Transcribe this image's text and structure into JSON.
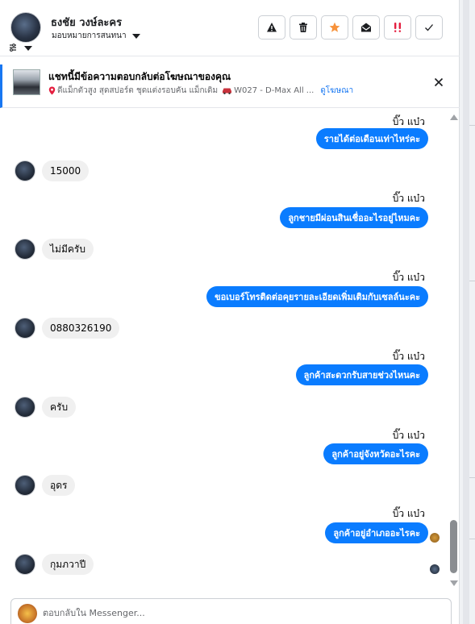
{
  "header": {
    "name": "ธงชัย วงษ์ละคร",
    "assign_label": "มอบหมายการสนทนา",
    "actions": [
      {
        "icon": "warning-icon",
        "name": "spam-button"
      },
      {
        "icon": "trash-icon",
        "name": "delete-button"
      },
      {
        "icon": "star-icon",
        "name": "follow-up-button"
      },
      {
        "icon": "envelope-open-icon",
        "name": "mark-unread-button"
      },
      {
        "icon": "exclamation-icon",
        "name": "priority-button"
      },
      {
        "icon": "check-icon",
        "name": "done-button"
      }
    ]
  },
  "ad": {
    "title": "แชทนี้มีข้อความตอบกลับต่อโฆษณาของคุณ",
    "description": "ดีแม็กตัวสูง สุดสปอร์ต ชุดแต่งรอบคัน แม็กเดิม",
    "code": "W027 - D-Max All ...",
    "link": "ดูโฆษณา"
  },
  "messages": [
    {
      "dir": "out",
      "sender": "บิ๊ว แบ๋ว",
      "text": "รายได้ต่อเดือนเท่าไหร่คะ"
    },
    {
      "dir": "in",
      "text": "15000"
    },
    {
      "dir": "out",
      "sender": "บิ๊ว แบ๋ว",
      "text": "ลูกชายมีผ่อนสินเชื่ออะไรอยู่ไหมคะ"
    },
    {
      "dir": "in",
      "text": "ไม่มีครับ"
    },
    {
      "dir": "out",
      "sender": "บิ๊ว แบ๋ว",
      "text": "ขอเบอร์โทรติดต่อคุยรายละเอียดเพิ่มเติมกับเซลล์นะคะ"
    },
    {
      "dir": "in",
      "text": "0880326190"
    },
    {
      "dir": "out",
      "sender": "บิ๊ว แบ๋ว",
      "text": "ลูกค้าสะดวกรับสายช่วงไหนคะ"
    },
    {
      "dir": "in",
      "text": "ครับ"
    },
    {
      "dir": "out",
      "sender": "บิ๊ว แบ๋ว",
      "text": "ลูกค้าอยู่จังหวัดอะไรคะ"
    },
    {
      "dir": "in",
      "text": "อุดร"
    },
    {
      "dir": "out",
      "sender": "บิ๊ว แบ๋ว",
      "text": "ลูกค้าอยู่อำเภออะไรคะ"
    },
    {
      "dir": "in",
      "text": "กุมภวาปี"
    }
  ],
  "composer": {
    "placeholder": "ตอบกลับใน Messenger..."
  },
  "colors": {
    "accent": "#0a7cff",
    "incoming_bubble": "#f0f0f0",
    "link": "#1877f2",
    "priority": "#e41e3f",
    "star": "#f7923b"
  }
}
